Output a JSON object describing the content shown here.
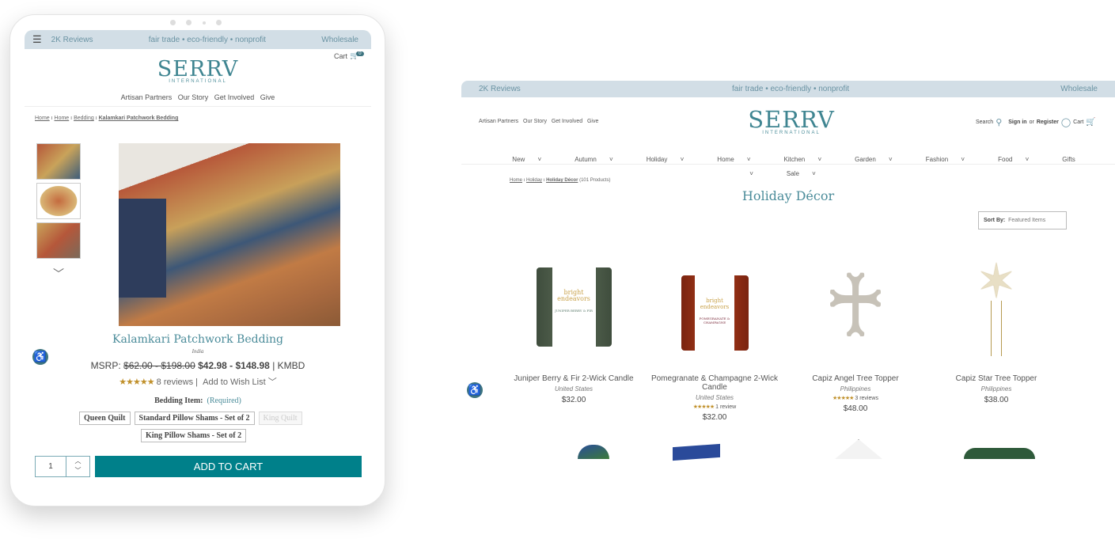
{
  "tablet": {
    "top_bar": {
      "reviews": "2K Reviews",
      "tagline": "fair trade • eco-friendly • nonprofit",
      "wholesale": "Wholesale"
    },
    "cart": {
      "label": "Cart",
      "count": "0"
    },
    "logo": {
      "name": "SERRV",
      "sub": "INTERNATIONAL"
    },
    "nav": [
      "Artisan Partners",
      "Our Story",
      "Get Involved",
      "Give"
    ],
    "breadcrumb": [
      "Home",
      "Home",
      "Bedding",
      "Kalamkari Patchwork Bedding"
    ],
    "product": {
      "title": "Kalamkari Patchwork Bedding",
      "origin": "India",
      "msrp_label": "MSRP:",
      "msrp": "$62.00 - $198.00",
      "price": "$42.98 - $148.98",
      "sku": "| KMBD",
      "stars": "★★★★★",
      "reviews": "8 reviews",
      "wishlist": "Add to Wish List",
      "option_label": "Bedding Item:",
      "required": "(Required)",
      "options": [
        "Queen Quilt",
        "Standard Pillow Shams - Set of 2",
        "King Quilt",
        "King Pillow Shams - Set of 2"
      ],
      "quantity": "1",
      "add_to_cart": "ADD TO CART"
    }
  },
  "desktop": {
    "top_bar": {
      "reviews": "2K Reviews",
      "tagline": "fair trade • eco-friendly • nonprofit",
      "wholesale": "Wholesale"
    },
    "links": [
      "Artisan Partners",
      "Our Story",
      "Get Involved",
      "Give"
    ],
    "logo": {
      "name": "SERRV",
      "sub": "INTERNATIONAL"
    },
    "account": {
      "search": "Search",
      "sign_in": "Sign in",
      "or": "or",
      "register": "Register",
      "cart": "Cart"
    },
    "nav": [
      "New",
      "Autumn",
      "Holiday",
      "Home",
      "Kitchen",
      "Garden",
      "Fashion",
      "Food",
      "Gifts",
      "Sale"
    ],
    "breadcrumb": {
      "home": "Home",
      "holiday": "Holiday",
      "current": "Holiday Décor",
      "count": "(101 Products)"
    },
    "title": "Holiday Décor",
    "sort": {
      "label": "Sort By:",
      "value": "Featured Items"
    },
    "products": [
      {
        "name": "Juniper Berry & Fir 2-Wick Candle",
        "origin": "United States",
        "price": "$32.00",
        "brand": "bright endeavors",
        "scent": "JUNIPER BERRY & FIR"
      },
      {
        "name": "Pomegranate & Champagne 2-Wick Candle",
        "origin": "United States",
        "stars": "★★★★★",
        "reviews": "1 review",
        "price": "$32.00",
        "brand": "bright endeavors",
        "scent": "POMEGRANATE & CHAMPAGNE"
      },
      {
        "name": "Capiz Angel Tree Topper",
        "origin": "Philippines",
        "stars": "★★★★★",
        "reviews": "3 reviews",
        "price": "$48.00"
      },
      {
        "name": "Capiz Star Tree Topper",
        "origin": "Philippines",
        "price": "$38.00"
      }
    ]
  },
  "colors": {
    "accent": "#00808a",
    "bar": "#d2dee6",
    "title": "#4b8c9a",
    "stars": "#c0902a"
  }
}
